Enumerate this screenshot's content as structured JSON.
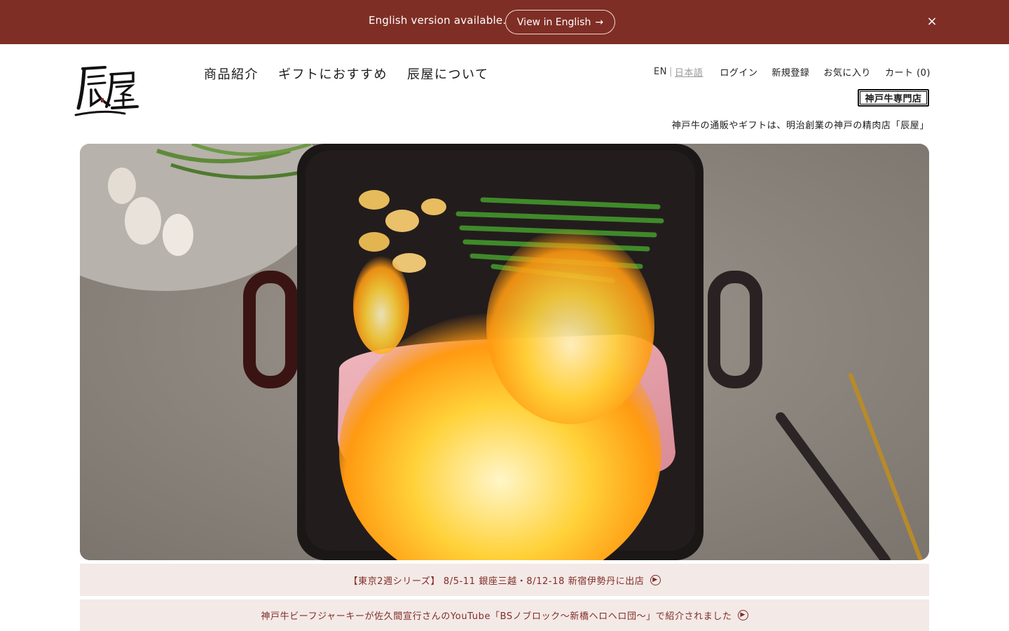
{
  "banner": {
    "message": "English version available.",
    "button_label": "View in English",
    "button_arrow": "→",
    "close_icon": "×"
  },
  "logo": {
    "text": "辰屋"
  },
  "nav": {
    "items": [
      {
        "label": "商品紹介"
      },
      {
        "label": "ギフトにおすすめ"
      },
      {
        "label": "辰屋について"
      }
    ]
  },
  "utility": {
    "lang_en": "EN",
    "lang_sep": "|",
    "lang_ja": "日本語",
    "login": "ログイン",
    "register": "新規登録",
    "favorites": "お気に入り",
    "cart": "カート (0)"
  },
  "badge": {
    "label": "神戸牛専門店"
  },
  "tagline": "神戸牛の通販やギフトは、明治創業の神戸の精肉店「辰屋」",
  "news": [
    {
      "text": "【東京2週シリーズ】 8/5-11 銀座三越・8/12-18 新宿伊勢丹に出店"
    },
    {
      "text": "神戸牛ビーフジャーキーが佐久間宣行さんのYouTube「BSノブロック〜新橋ヘロヘロ団〜」で紹介されました"
    }
  ],
  "colors": {
    "brand": "#7f2e25",
    "news_bg": "#f3e9e7"
  },
  "icons": {
    "close": "close-icon",
    "news_arrow": "circle-arrow-right-icon",
    "banner_arrow": "arrow-right-icon"
  }
}
